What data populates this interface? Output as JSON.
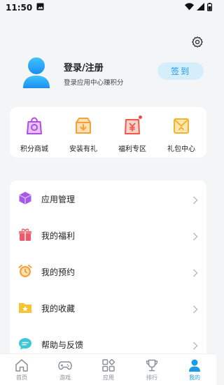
{
  "status_bar": {
    "time": "11:50",
    "icons": [
      "image-icon",
      "wifi-icon",
      "signal-icon",
      "battery-icon"
    ]
  },
  "header": {
    "settings_icon": "gear-icon"
  },
  "profile": {
    "title": "登录/注册",
    "subtitle": "登录应用中心赚积分",
    "signin_label": "签到",
    "accent": "#1e9be8"
  },
  "quick_actions": [
    {
      "label": "积分商城",
      "icon": "shopping-bag-icon",
      "color": "#b04de6"
    },
    {
      "label": "安装有礼",
      "icon": "install-gift-icon",
      "color": "#f3a23a"
    },
    {
      "label": "福利专区",
      "icon": "yuan-bag-icon",
      "color": "#ef5a4a",
      "badge": true
    },
    {
      "label": "礼包中心",
      "icon": "gift-mail-icon",
      "color": "#f4b232"
    }
  ],
  "menu": [
    {
      "label": "应用管理",
      "icon": "cube-icon"
    },
    {
      "label": "我的福利",
      "icon": "gift-icon"
    },
    {
      "label": "我的预约",
      "icon": "alarm-clock-icon"
    },
    {
      "label": "我的收藏",
      "icon": "star-folder-icon"
    },
    {
      "label": "帮助与反馈",
      "icon": "chat-bubble-icon"
    }
  ],
  "tabs": [
    {
      "label": "首页",
      "icon": "home-icon",
      "active": false
    },
    {
      "label": "游戏",
      "icon": "gamepad-icon",
      "active": false
    },
    {
      "label": "应用",
      "icon": "apps-grid-icon",
      "active": false
    },
    {
      "label": "排行",
      "icon": "trophy-icon",
      "active": false
    },
    {
      "label": "我的",
      "icon": "user-icon",
      "active": true
    }
  ]
}
